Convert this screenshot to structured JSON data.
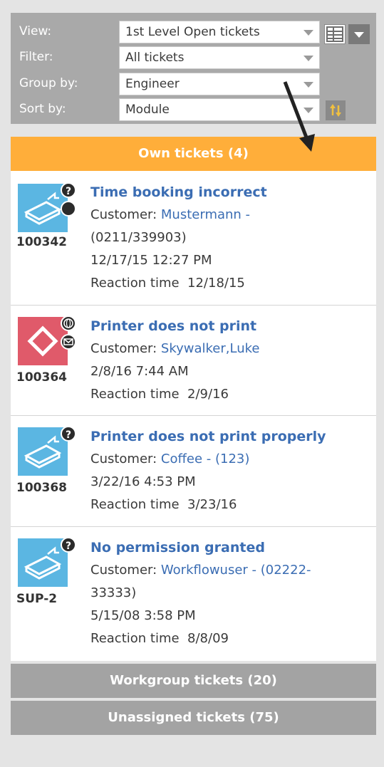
{
  "filters": [
    {
      "label": "View:",
      "value": "1st Level Open tickets"
    },
    {
      "label": "Filter:",
      "value": "All tickets"
    },
    {
      "label": "Group by:",
      "value": "Engineer"
    },
    {
      "label": "Sort by:",
      "value": "Module"
    }
  ],
  "groups": {
    "own": "Own tickets (4)",
    "workgroup": "Workgroup tickets (20)",
    "unassigned": "Unassigned tickets (75)"
  },
  "customer_label": "Customer: ",
  "reaction_label": "Reaction time",
  "tickets": [
    {
      "number": "100342",
      "title": "Time booking incorrect",
      "customer_line1": "Mustermann -",
      "customer_line2": "(0211/339903)",
      "datetime": "12/17/15 12:27 PM",
      "reaction": "12/18/15",
      "icon": "support-box-icon",
      "icon_color": "#5bb6e2"
    },
    {
      "number": "100364",
      "title": "Printer does not print",
      "customer_line1": "Skywalker,Luke",
      "datetime": "2/8/16 7:44 AM",
      "reaction": "2/9/16",
      "icon": "warning-diamond-icon",
      "icon_color": "#e05a6a"
    },
    {
      "number": "100368",
      "title": "Printer does not print properly",
      "customer_line1": "Coffee - (123)",
      "datetime": "3/22/16 4:53 PM",
      "reaction": "3/23/16",
      "icon": "support-box-icon",
      "icon_color": "#5bb6e2"
    },
    {
      "number": "SUP-2",
      "title": "No permission granted",
      "customer_line1": "Workflowuser - (02222-",
      "customer_line2": "33333)",
      "datetime": "5/15/08 3:58 PM",
      "reaction": "8/8/09",
      "icon": "support-box-icon",
      "icon_color": "#5bb6e2"
    }
  ],
  "colors": {
    "accent": "#ffae3a",
    "link": "#3b6db3",
    "panel": "#a9a9a9",
    "sort_button": "#c8a046"
  }
}
